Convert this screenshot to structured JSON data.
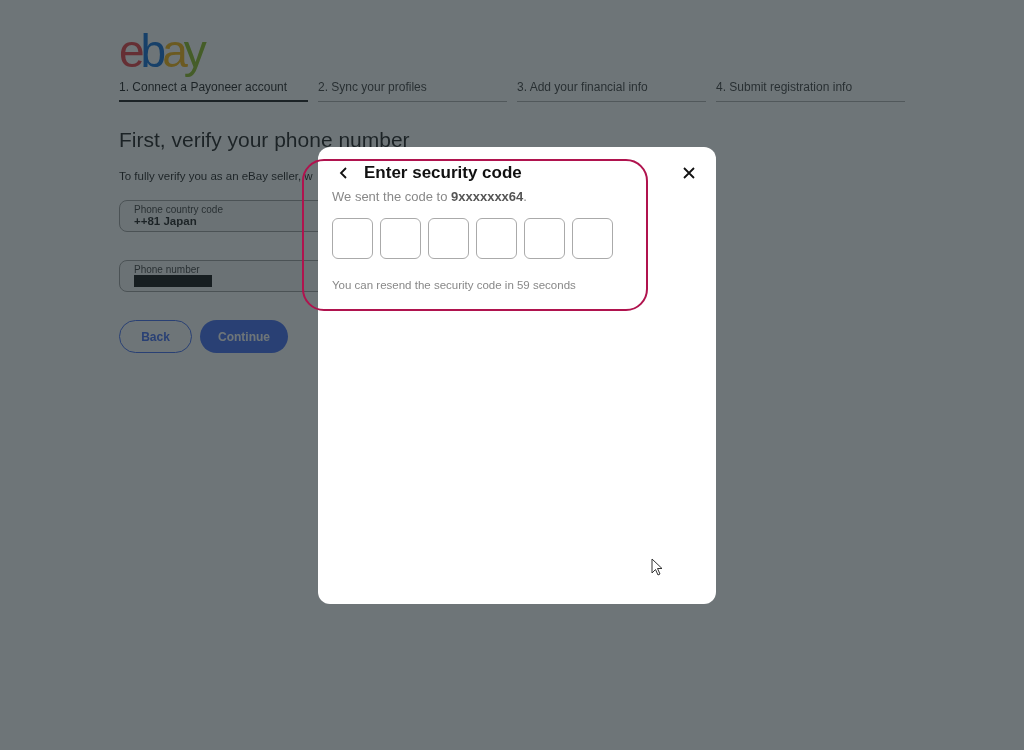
{
  "logo": "ebay",
  "steps": [
    {
      "label": "1. Connect a Payoneer account",
      "selected": true
    },
    {
      "label": "2. Sync your profiles",
      "selected": false
    },
    {
      "label": "3. Add your financial info",
      "selected": false
    },
    {
      "label": "4. Submit registration info",
      "selected": false
    }
  ],
  "heading": "First, verify your phone number",
  "intro": "To fully verify you as an eBay seller, w",
  "fields": [
    {
      "label": "Phone country code",
      "value": "++81 Japan",
      "redacted": false
    },
    {
      "label": "Phone number",
      "redacted": true
    }
  ],
  "buttons": [
    {
      "label": "Back",
      "kind": "secondary"
    },
    {
      "label": "Continue",
      "kind": "primary"
    }
  ],
  "dialog": {
    "title": "Enter security code",
    "sent_text": "We sent the code to **9xxxxxxx64**.",
    "code_inputs": [
      {
        "filled": false
      },
      {
        "filled": false
      },
      {
        "filled": false
      },
      {
        "filled": false
      },
      {
        "filled": false
      },
      {
        "filled": false
      }
    ],
    "resend_text": "You can resend the security code in 59 seconds",
    "highlighted": true
  }
}
